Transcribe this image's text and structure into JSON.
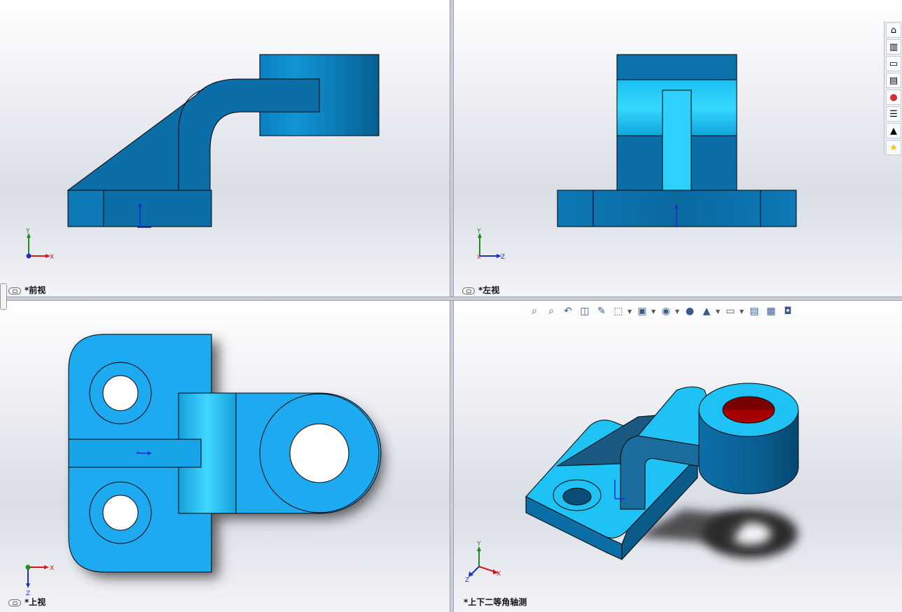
{
  "viewports": {
    "front": {
      "label": "*前视",
      "axes": {
        "vertical": "Y",
        "horizontal": "X"
      }
    },
    "left": {
      "label": "*左视",
      "axes": {
        "vertical": "Y",
        "horizontal": "Z"
      }
    },
    "top": {
      "label": "*上视",
      "axes": {
        "vertical": "Z",
        "horizontal": "X"
      }
    },
    "iso": {
      "label": "*上下二等角轴测",
      "axes": {
        "vertical": "Y",
        "horizontal": "X",
        "depth": "Z"
      }
    }
  },
  "taskpane": [
    "home-icon",
    "parts-library-icon",
    "folder-icon",
    "view-palette-icon",
    "appearance-icon",
    "properties-icon",
    "tutorial-icon",
    "favorites-icon"
  ],
  "heads_up_toolbar": [
    "zoom-to-fit-icon",
    "zoom-area-icon",
    "previous-view-icon",
    "section-view-icon",
    "dynamic-annotation-icon",
    "view-orientation-icon",
    "display-style-icon",
    "hide-show-icon",
    "edit-appearance-icon",
    "apply-scene-icon",
    "view-settings-icon",
    "display-pane-icon",
    "screen-capture-icon",
    "camera-icon"
  ],
  "colors": {
    "model": "#1aa6e8",
    "model_dark": "#0a6aa0",
    "hole": "#b00000",
    "shadow": "#3a3a3a"
  }
}
